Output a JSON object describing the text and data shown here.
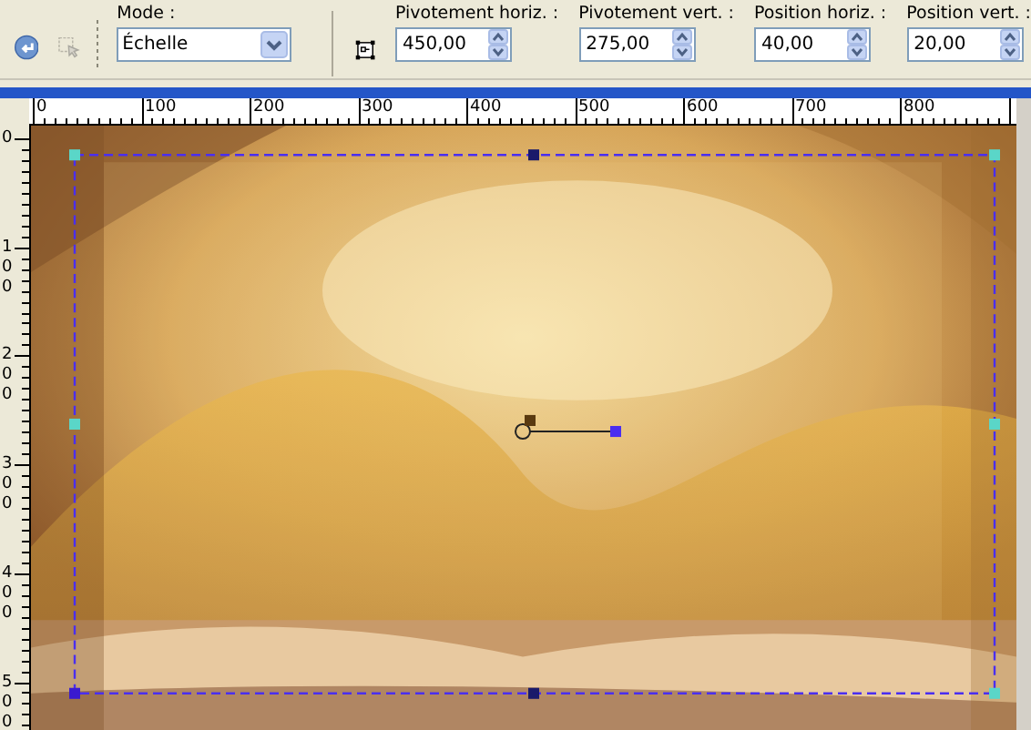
{
  "toolbar": {
    "mode": {
      "label": "Mode :",
      "value": "Échelle"
    },
    "fields": [
      {
        "label": "Pivotement horiz. :",
        "value": "450,00"
      },
      {
        "label": "Pivotement vert. :",
        "value": "275,00"
      },
      {
        "label": "Position horiz. :",
        "value": "40,00"
      },
      {
        "label": "Position vert. :",
        "value": "20,00"
      }
    ]
  },
  "rulers": {
    "horizontal": [
      "0",
      "100",
      "200",
      "300",
      "400",
      "500",
      "600",
      "700",
      "800"
    ],
    "vertical": [
      "0",
      "100",
      "200",
      "300",
      "400",
      "500"
    ]
  }
}
